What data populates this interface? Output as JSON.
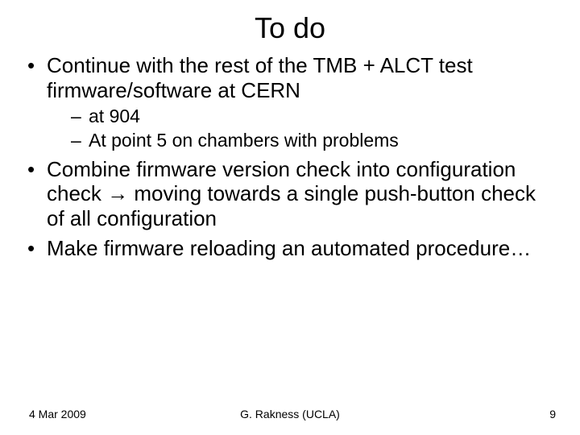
{
  "title": "To do",
  "bullets": {
    "b1": "Continue with the rest of the TMB + ALCT test firmware/software at CERN",
    "b1_sub1": "at 904",
    "b1_sub2": "At point 5 on chambers with problems",
    "b2_pre": "Combine firmware version check into configuration check ",
    "b2_arrow": "→",
    "b2_post": " moving towards a single push-button check of all configuration",
    "b3": "Make firmware reloading an automated procedure…"
  },
  "footer": {
    "date": "4 Mar 2009",
    "author": "G. Rakness (UCLA)",
    "page": "9"
  }
}
